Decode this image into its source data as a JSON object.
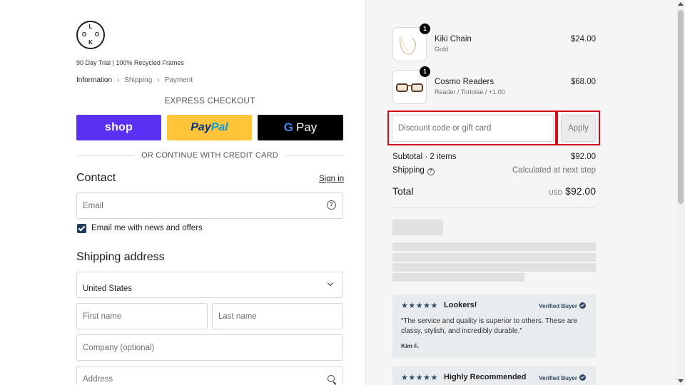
{
  "brand": {
    "logo_letters": [
      "L",
      "O",
      "O",
      "K"
    ],
    "tagline": "90 Day Trial | 100% Recycled Frames"
  },
  "breadcrumb": {
    "items": [
      "Information",
      "Shipping",
      "Payment"
    ],
    "separator": "›"
  },
  "express": {
    "label": "EXPRESS CHECKOUT",
    "shop_label": "shop",
    "paypal_part1": "Pay",
    "paypal_part2": "Pal",
    "gpay_g": "G",
    "gpay_label": "Pay"
  },
  "divider_text": "OR CONTINUE WITH CREDIT CARD",
  "contact": {
    "heading": "Contact",
    "signin": "Sign in",
    "email_placeholder": "Email",
    "newsletter_label": "Email me with news and offers",
    "newsletter_checked": true
  },
  "shipping": {
    "heading": "Shipping address",
    "country": "United States",
    "first_name_placeholder": "First name",
    "last_name_placeholder": "Last name",
    "company_placeholder": "Company (optional)",
    "address_placeholder": "Address"
  },
  "cart": {
    "items": [
      {
        "name": "Kiki Chain",
        "variant": "Gold",
        "price": "$24.00",
        "qty": "1"
      },
      {
        "name": "Cosmo Readers",
        "variant": "Reader / Tortoise / +1.00",
        "price": "$68.00",
        "qty": "1"
      }
    ],
    "discount_placeholder": "Discount code or gift card",
    "apply_label": "Apply",
    "subtotal_label": "Subtotal · 2 items",
    "subtotal_value": "$92.00",
    "shipping_label": "Shipping",
    "shipping_value": "Calculated at next step",
    "total_label": "Total",
    "currency": "USD",
    "total_value": "$92.00"
  },
  "reviews": [
    {
      "stars": "★★★★★",
      "title": "Lookers!",
      "verified": "Verified Buyer",
      "text": "“The service and quality is superior to others. These are classy, stylish, and incredibly durable.”",
      "author": "Kim F."
    },
    {
      "stars": "★★★★★",
      "title": "Highly Recommended",
      "verified": "Verified Buyer"
    }
  ],
  "colors": {
    "shop": "#5a31f4",
    "paypal": "#ffc439",
    "gpay": "#000000",
    "highlight": "#d10d1a",
    "accent": "#1f3a5a"
  }
}
